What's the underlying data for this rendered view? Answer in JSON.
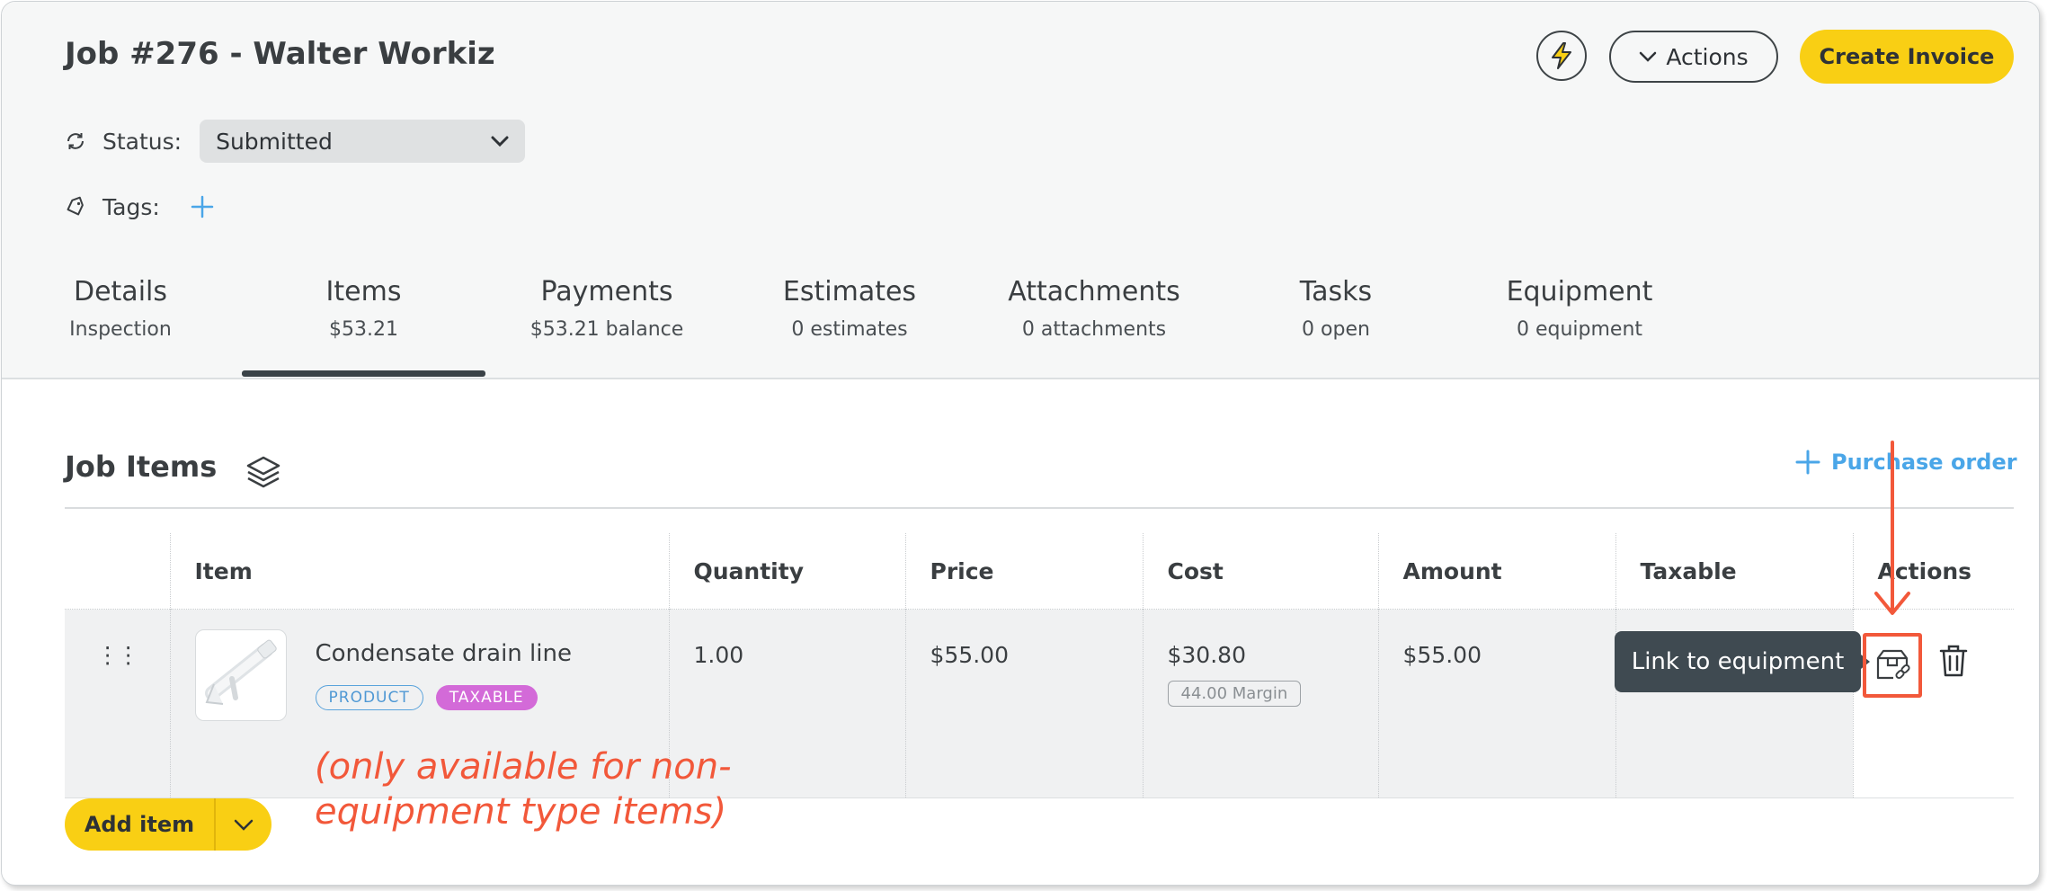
{
  "header": {
    "title": "Job #276 - Walter Workiz",
    "actions_label": "Actions",
    "create_invoice_label": "Create Invoice"
  },
  "status": {
    "label": "Status:",
    "value": "Submitted"
  },
  "tags": {
    "label": "Tags:"
  },
  "tabs": [
    {
      "title": "Details",
      "sub": "Inspection"
    },
    {
      "title": "Items",
      "sub": "$53.21"
    },
    {
      "title": "Payments",
      "sub": "$53.21 balance"
    },
    {
      "title": "Estimates",
      "sub": "0 estimates"
    },
    {
      "title": "Attachments",
      "sub": "0 attachments"
    },
    {
      "title": "Tasks",
      "sub": "0 open"
    },
    {
      "title": "Equipment",
      "sub": "0 equipment"
    }
  ],
  "active_tab": "Items",
  "job_items": {
    "title": "Job Items",
    "purchase_order_label": "Purchase order",
    "columns": [
      "Item",
      "Quantity",
      "Price",
      "Cost",
      "Amount",
      "Taxable",
      "Actions"
    ],
    "rows": [
      {
        "name": "Condensate drain line",
        "badge_type": "PRODUCT",
        "badge_taxable": "TAXABLE",
        "quantity": "1.00",
        "price": "$55.00",
        "cost": "$30.80",
        "margin": "44.00 Margin",
        "amount": "$55.00"
      }
    ],
    "add_item_label": "Add item"
  },
  "tooltip": {
    "text": "Link to equipment"
  },
  "annotation": {
    "line1": "(only available for non-",
    "line2": "equipment type items)"
  },
  "colors": {
    "accent_yellow": "#f9cf14",
    "link_blue": "#4aa6e8",
    "annotation_red": "#f2583a",
    "tooltip_bg": "#3f4a51",
    "taxable_purple": "#d36ad8"
  }
}
